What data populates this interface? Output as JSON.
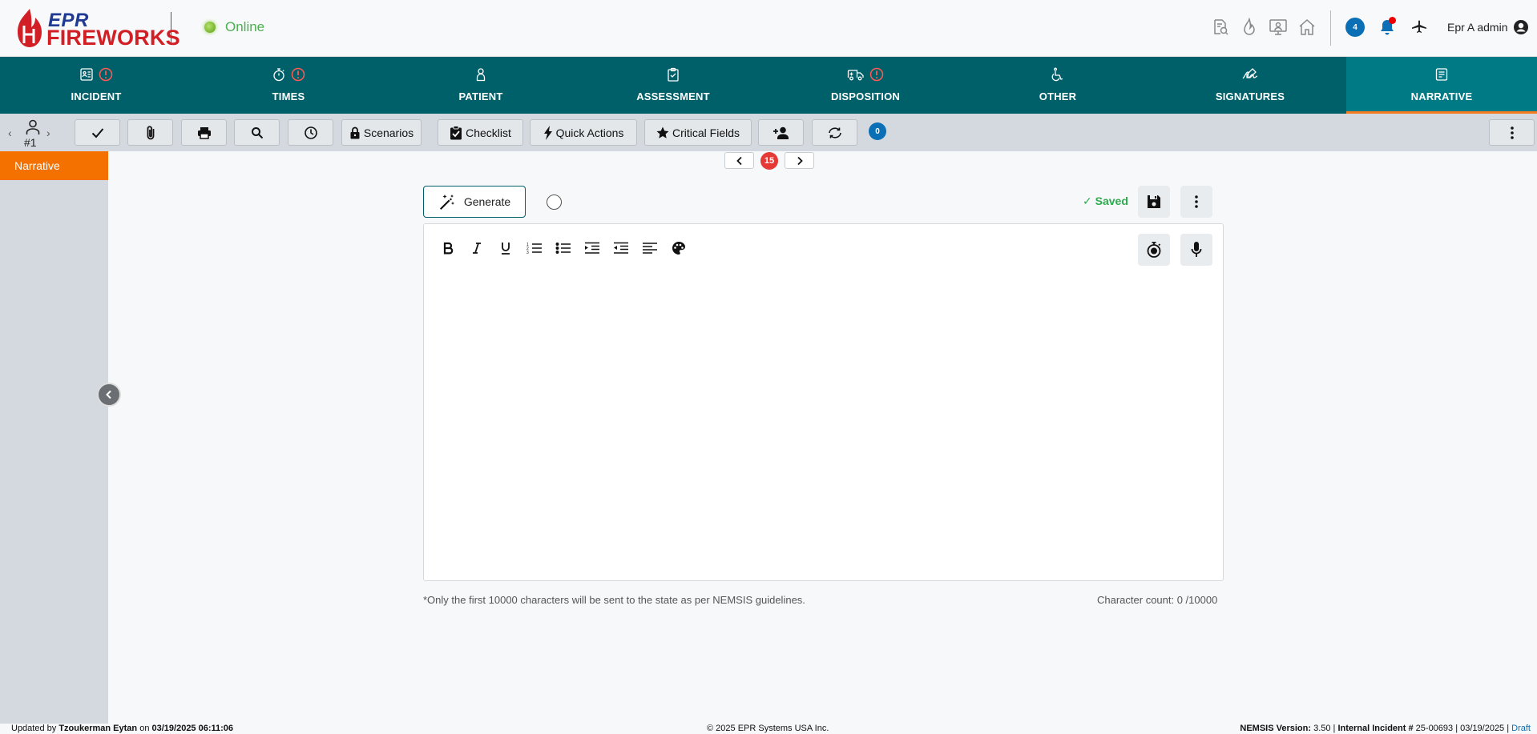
{
  "header": {
    "logo_line1": "EPR",
    "logo_line2": "FIREWORKS",
    "status": "Online",
    "icons": [
      "search-document-icon",
      "flame-icon",
      "presenter-icon",
      "home-icon",
      "chat-icon",
      "bell-icon",
      "airplane-icon",
      "user-circle-icon"
    ],
    "chat_count": "4",
    "user_name": "Epr A admin"
  },
  "nav": {
    "tabs": [
      {
        "label": "INCIDENT",
        "icon": "id-card-icon",
        "alert": true
      },
      {
        "label": "TIMES",
        "icon": "stopwatch-icon",
        "alert": true
      },
      {
        "label": "PATIENT",
        "icon": "person-icon",
        "alert": false
      },
      {
        "label": "ASSESSMENT",
        "icon": "clipboard-icon",
        "alert": false
      },
      {
        "label": "DISPOSITION",
        "icon": "ambulance-icon",
        "alert": true
      },
      {
        "label": "OTHER",
        "icon": "wheelchair-icon",
        "alert": false
      },
      {
        "label": "SIGNATURES",
        "icon": "signature-icon",
        "alert": false
      },
      {
        "label": "NARRATIVE",
        "icon": "narrative-icon",
        "alert": false,
        "active": true
      }
    ]
  },
  "toolbar": {
    "patient_number": "#1",
    "scenarios": "Scenarios",
    "checklist": "Checklist",
    "quick_actions": "Quick Actions",
    "critical_fields": "Critical Fields",
    "badge_count": "0"
  },
  "sidebar": {
    "items": [
      {
        "label": "Narrative",
        "active": true
      }
    ]
  },
  "pager": {
    "count": "15"
  },
  "editor": {
    "generate_label": "Generate",
    "saved_text": "✓ Saved",
    "footnote": "*Only the first 10000 characters will be sent to the state as per NEMSIS guidelines.",
    "char_count": "Character count: 0 /10000",
    "format_buttons": [
      "bold-icon",
      "italic-icon",
      "underline-icon",
      "ordered-list-icon",
      "bullet-list-icon",
      "indent-icon",
      "outdent-icon",
      "align-icon",
      "palette-icon"
    ]
  },
  "footer": {
    "updated_prefix": "Updated by ",
    "updated_user": "Tzoukerman Eytan",
    "updated_on": " on ",
    "updated_date": "03/19/2025 06:11:06",
    "copyright": "© 2025 EPR Systems USA Inc.",
    "nemsis_label": "NEMSIS Version:",
    "nemsis_value": " 3.50 | ",
    "incident_label": "Internal Incident #",
    "incident_value": " 25-00693 | 03/19/2025 | ",
    "status": "Draft"
  },
  "colors": {
    "nav_bg": "#00606a",
    "nav_active": "#007b86",
    "accent_orange": "#f47100",
    "online_green": "#4caf50",
    "saved_green": "#2eaa4f",
    "alert_red": "#e53935",
    "brand_red": "#d21f26",
    "brand_blue": "#1f3a93"
  }
}
